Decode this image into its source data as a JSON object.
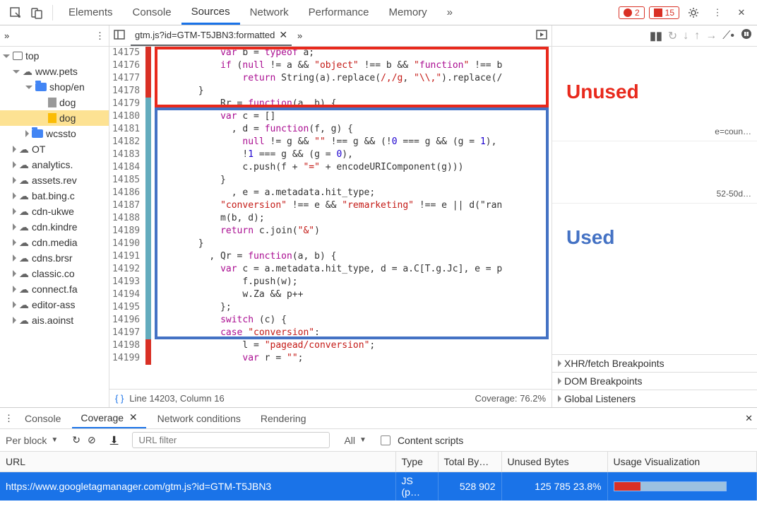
{
  "toolbar": {
    "tabs": [
      "Elements",
      "Console",
      "Sources",
      "Network",
      "Performance",
      "Memory"
    ],
    "active_index": 2,
    "errors": "2",
    "warnings": "15"
  },
  "file_tree": {
    "top": "top",
    "items": [
      {
        "label": "www.pets",
        "lv": 1,
        "icon": "cloud",
        "open": true
      },
      {
        "label": "shop/en",
        "lv": 2,
        "icon": "folder",
        "open": true
      },
      {
        "label": "dog",
        "lv": 3,
        "icon": "file"
      },
      {
        "label": "dog",
        "lv": 3,
        "icon": "file-y",
        "selected": true
      },
      {
        "label": "wcssto",
        "lv": 2,
        "icon": "folder",
        "closed": true
      },
      {
        "label": "OT",
        "lv": 1,
        "icon": "cloud",
        "closed": true
      },
      {
        "label": "analytics.",
        "lv": 1,
        "icon": "cloud",
        "closed": true
      },
      {
        "label": "assets.rev",
        "lv": 1,
        "icon": "cloud",
        "closed": true
      },
      {
        "label": "bat.bing.c",
        "lv": 1,
        "icon": "cloud",
        "closed": true
      },
      {
        "label": "cdn-ukwe",
        "lv": 1,
        "icon": "cloud",
        "closed": true
      },
      {
        "label": "cdn.kindre",
        "lv": 1,
        "icon": "cloud",
        "closed": true
      },
      {
        "label": "cdn.media",
        "lv": 1,
        "icon": "cloud",
        "closed": true
      },
      {
        "label": "cdns.brsr",
        "lv": 1,
        "icon": "cloud",
        "closed": true
      },
      {
        "label": "classic.co",
        "lv": 1,
        "icon": "cloud",
        "closed": true
      },
      {
        "label": "connect.fa",
        "lv": 1,
        "icon": "cloud",
        "closed": true
      },
      {
        "label": "editor-ass",
        "lv": 1,
        "icon": "cloud",
        "closed": true
      },
      {
        "label": "ais.aoinst",
        "lv": 1,
        "icon": "cloud",
        "closed": true
      }
    ]
  },
  "editor": {
    "filename": "gtm.js?id=GTM-T5JBN3:formatted",
    "line_start": 14175,
    "line_end": 14199,
    "cursor_status": "Line 14203, Column 16",
    "coverage_status": "Coverage: 76.2%",
    "coverage_gutter": [
      "red",
      "red",
      "red",
      "red",
      "blue",
      "blue",
      "blue",
      "blue",
      "blue",
      "blue",
      "blue",
      "blue",
      "blue",
      "blue",
      "blue",
      "blue",
      "blue",
      "blue",
      "blue",
      "blue",
      "blue",
      "blue",
      "blue",
      "red",
      "red"
    ],
    "code_lines": [
      "            var b = typeof a;",
      "            if (null != a && \"object\" !== b && \"function\" !== b",
      "                return String(a).replace(/,/g, \"\\\\,\").replace(/",
      "        }",
      "          , Rr = function(a, b) {",
      "            var c = []",
      "              , d = function(f, g) {",
      "                null != g && \"\" !== g && (!0 === g && (g = 1),",
      "                !1 === g && (g = 0),",
      "                c.push(f + \"=\" + encodeURIComponent(g)))",
      "            }",
      "              , e = a.metadata.hit_type;",
      "            \"conversion\" !== e && \"remarketing\" !== e || d(\"ran",
      "            m(b, d);",
      "            return c.join(\"&\")",
      "        }",
      "          , Qr = function(a, b) {",
      "            var c = a.metadata.hit_type, d = a.C[T.g.Jc], e = p",
      "                f.push(w);",
      "                w.Za && p++",
      "            };",
      "            switch (c) {",
      "            case \"conversion\":",
      "                l = \"pagead/conversion\";",
      "                var r = \"\";"
    ]
  },
  "annotations": {
    "unused": "Unused",
    "used": "Used"
  },
  "right_stubs": [
    "e=coun…",
    "52-50d…"
  ],
  "debug_panes": [
    "XHR/fetch Breakpoints",
    "DOM Breakpoints",
    "Global Listeners"
  ],
  "drawer": {
    "tabs": [
      "Console",
      "Coverage",
      "Network conditions",
      "Rendering"
    ],
    "active_index": 1,
    "per_block": "Per block",
    "url_filter_placeholder": "URL filter",
    "type_filter": "All",
    "content_scripts": "Content scripts",
    "headers": [
      "URL",
      "Type",
      "Total By…",
      "Unused Bytes",
      "Usage Visualization"
    ],
    "row": {
      "url": "https://www.googletagmanager.com/gtm.js?id=GTM-T5JBN3",
      "type": "JS (p…",
      "total": "528 902",
      "unused": "125 785",
      "pct": "23.8%"
    }
  }
}
